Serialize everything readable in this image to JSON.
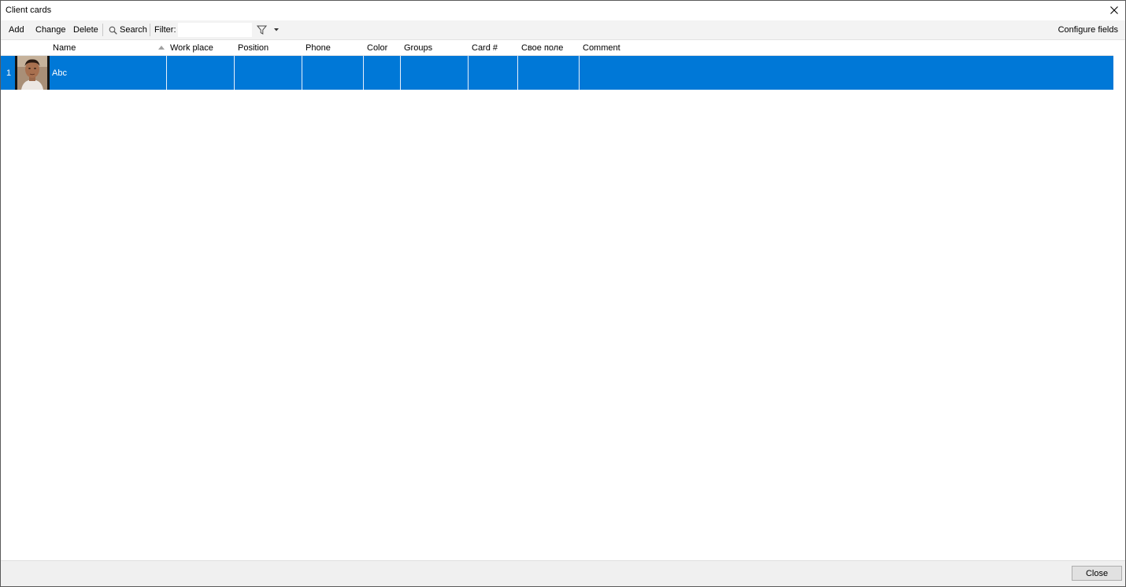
{
  "window": {
    "title": "Client cards"
  },
  "toolbar": {
    "add_label": "Add",
    "change_label": "Change",
    "delete_label": "Delete",
    "search_label": "Search",
    "filter_label": "Filter:",
    "filter_value": "",
    "configure_label": "Configure fields"
  },
  "table": {
    "columns": [
      "Name",
      "Work place",
      "Position",
      "Phone",
      "Color",
      "Groups",
      "Card #",
      "Свое поле",
      "Comment"
    ],
    "sort_column": "Name",
    "rows": [
      {
        "index": "1",
        "name": "Abc",
        "work_place": "",
        "position": "",
        "phone": "",
        "color": "",
        "groups": "",
        "card": "",
        "custom": "",
        "comment": ""
      }
    ]
  },
  "footer": {
    "close_label": "Close"
  },
  "colors": {
    "selection": "#0078d7",
    "toolbar_bg": "#f3f3f3",
    "footer_bg": "#f0f0f0"
  }
}
